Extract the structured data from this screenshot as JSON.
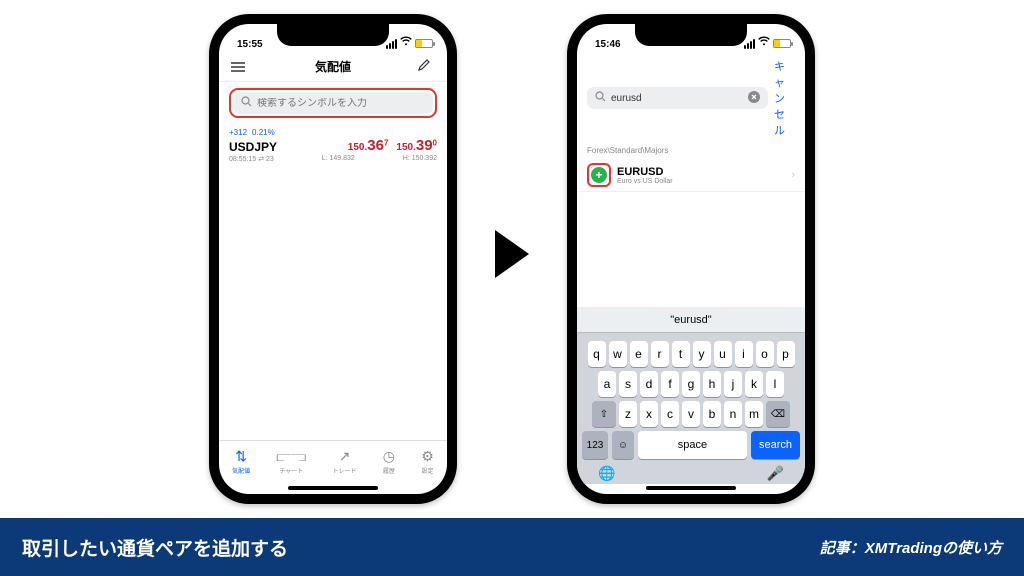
{
  "left_phone": {
    "status": {
      "time": "15:55"
    },
    "nav": {
      "title": "気配値"
    },
    "search": {
      "placeholder": "検索するシンボルを入力"
    },
    "quote": {
      "change": "+312",
      "pct": "0.21%",
      "symbol": "USDJPY",
      "bid_pre": "150.",
      "bid_big": "36",
      "bid_exp": "7",
      "ask_pre": "150.",
      "ask_big": "39",
      "ask_exp": "0",
      "time": "08:55:15",
      "spread": "23",
      "low_label": "L:",
      "low": "149.832",
      "high_label": "H:",
      "high": "150.392"
    },
    "toolbar": {
      "items": [
        {
          "label": "気配値",
          "icon": "↕"
        },
        {
          "label": "チャート",
          "icon": "⎍"
        },
        {
          "label": "トレード",
          "icon": "↗"
        },
        {
          "label": "履歴",
          "icon": "◷"
        },
        {
          "label": "設定",
          "icon": "⚙"
        }
      ]
    }
  },
  "right_phone": {
    "status": {
      "time": "15:46"
    },
    "search": {
      "value": "eurusd",
      "cancel": "キャンセル"
    },
    "category": "Forex\\Standard\\Majors",
    "result": {
      "symbol": "EURUSD",
      "desc": "Euro vs US Dollar"
    },
    "keyboard": {
      "suggestion": "\"eurusd\"",
      "row1": [
        "q",
        "w",
        "e",
        "r",
        "t",
        "y",
        "u",
        "i",
        "o",
        "p"
      ],
      "row2": [
        "a",
        "s",
        "d",
        "f",
        "g",
        "h",
        "j",
        "k",
        "l"
      ],
      "row3": [
        "z",
        "x",
        "c",
        "v",
        "b",
        "n",
        "m"
      ],
      "num_key": "123",
      "space": "space",
      "search": "search"
    }
  },
  "banner": {
    "left": "取引したい通貨ペアを追加する",
    "right": "記事：XMTradingの使い方"
  }
}
